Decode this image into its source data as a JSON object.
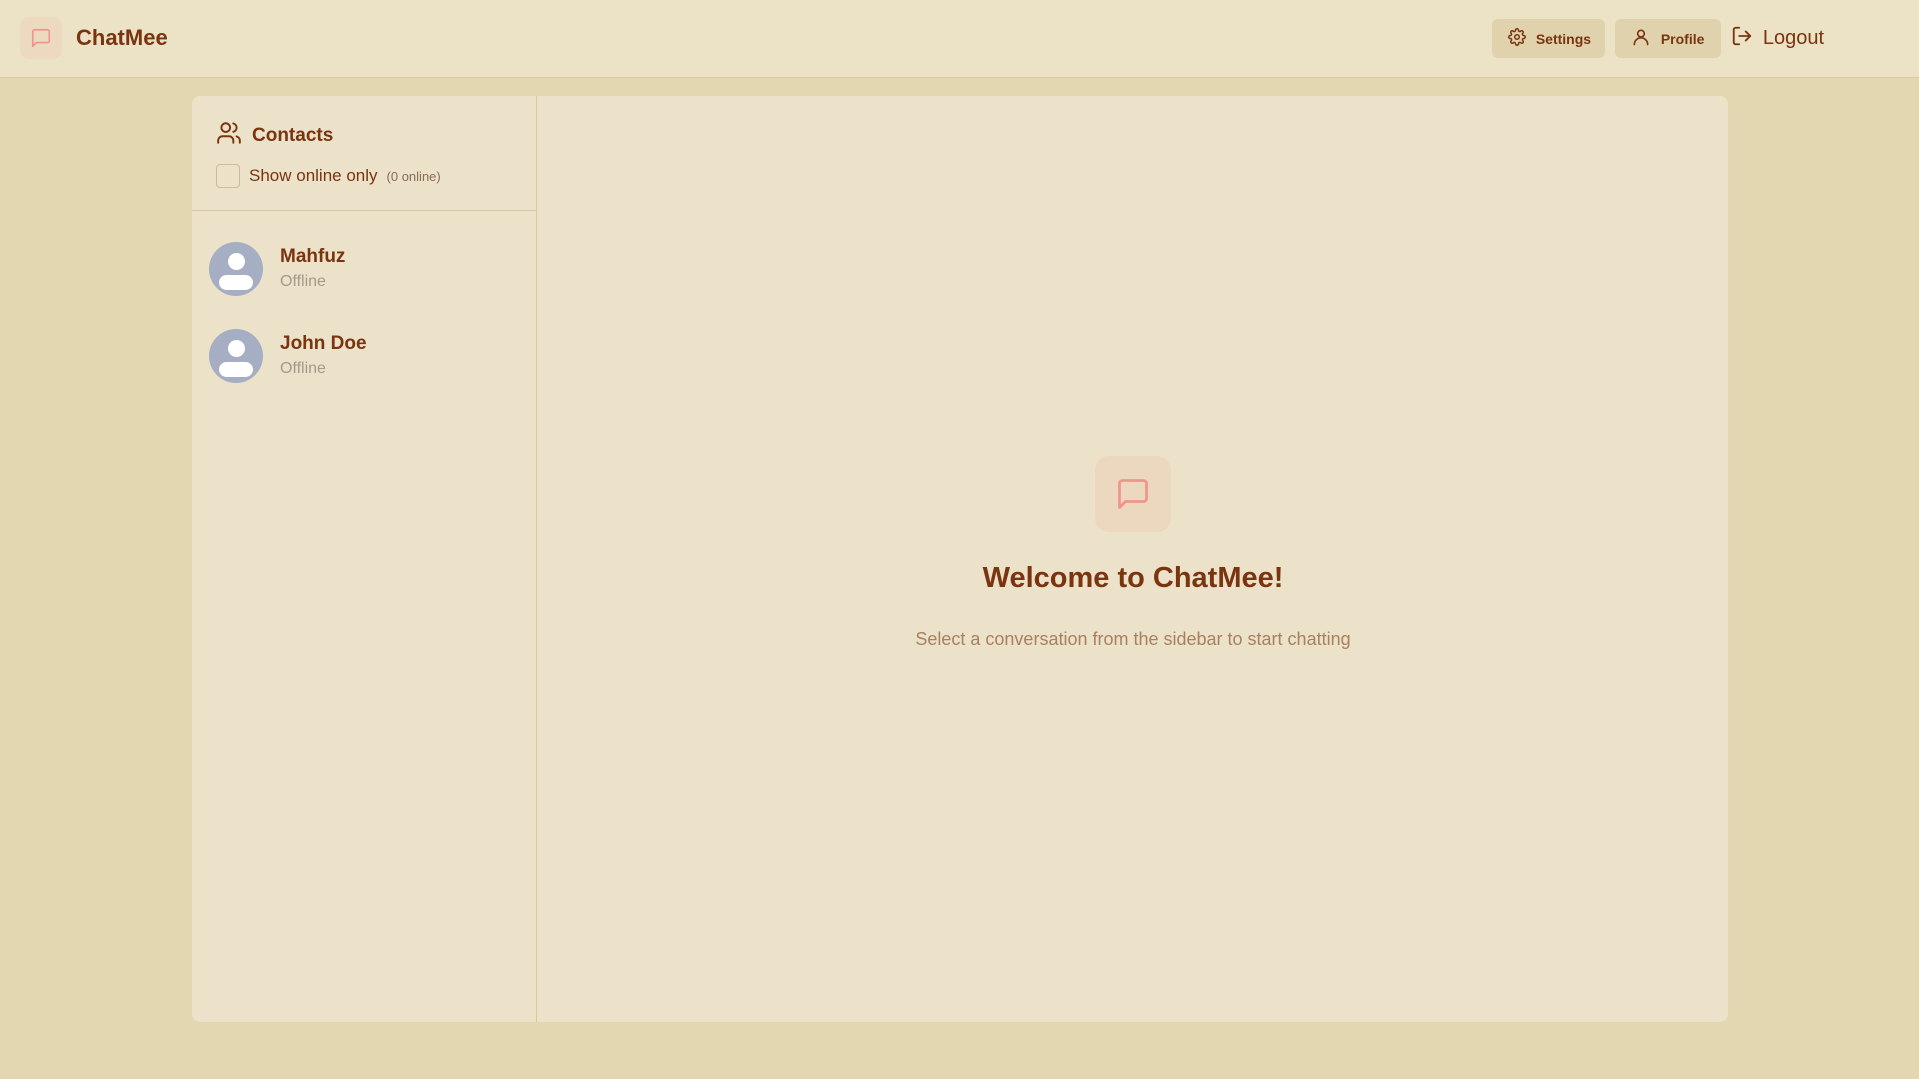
{
  "app": {
    "brand_name": "ChatMee",
    "brand_icon": "message-square-icon",
    "accent_color": "#f0958c"
  },
  "nav": {
    "settings_label": "Settings",
    "profile_label": "Profile",
    "logout_label": "Logout"
  },
  "sidebar": {
    "title": "Contacts",
    "filter_label": "Show online only",
    "online_count": "(0 online)",
    "show_online_only": false,
    "contacts": [
      {
        "name": "Mahfuz",
        "status": "Offline"
      },
      {
        "name": "John Doe",
        "status": "Offline"
      }
    ]
  },
  "welcome": {
    "title": "Welcome to ChatMee!",
    "subtitle": "Select a conversation from the sidebar to start chatting"
  }
}
